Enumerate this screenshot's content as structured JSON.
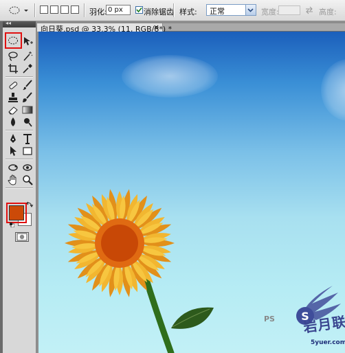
{
  "options_bar": {
    "feather_label": "羽化:",
    "feather_value": "0 px",
    "antialias_label": "消除锯齿",
    "antialias_checked": true,
    "style_label": "样式:",
    "style_value": "正常",
    "width_label": "宽度:",
    "height_label": "高度:"
  },
  "document_tab": {
    "title": "向日葵.psd @ 33.3% (11, RGB/8*) *",
    "close": "×"
  },
  "colors": {
    "foreground": "#cc4a08",
    "background": "#ffffff",
    "highlight": "#e01010"
  },
  "tools": [
    "rectangular-marquee-tool-icon",
    "elliptical-marquee-tool-icon",
    "move-tool-icon",
    "lasso-tool-icon",
    "magic-wand-tool-icon",
    "crop-tool-icon",
    "eyedropper-tool-icon",
    "healing-brush-tool-icon",
    "brush-tool-icon",
    "clone-stamp-tool-icon",
    "history-brush-tool-icon",
    "eraser-tool-icon",
    "gradient-tool-icon",
    "blur-tool-icon",
    "dodge-tool-icon",
    "pen-tool-icon",
    "type-tool-icon",
    "path-selection-tool-icon",
    "rectangle-shape-tool-icon",
    "3d-rotate-tool-icon",
    "3d-orbit-tool-icon",
    "hand-tool-icon",
    "zoom-tool-icon"
  ],
  "selected_tool": "elliptical-marquee-tool-icon",
  "watermark": {
    "main_text": "岩月联盟",
    "sub_text": "5yuer.com",
    "ps_text": "PS"
  }
}
